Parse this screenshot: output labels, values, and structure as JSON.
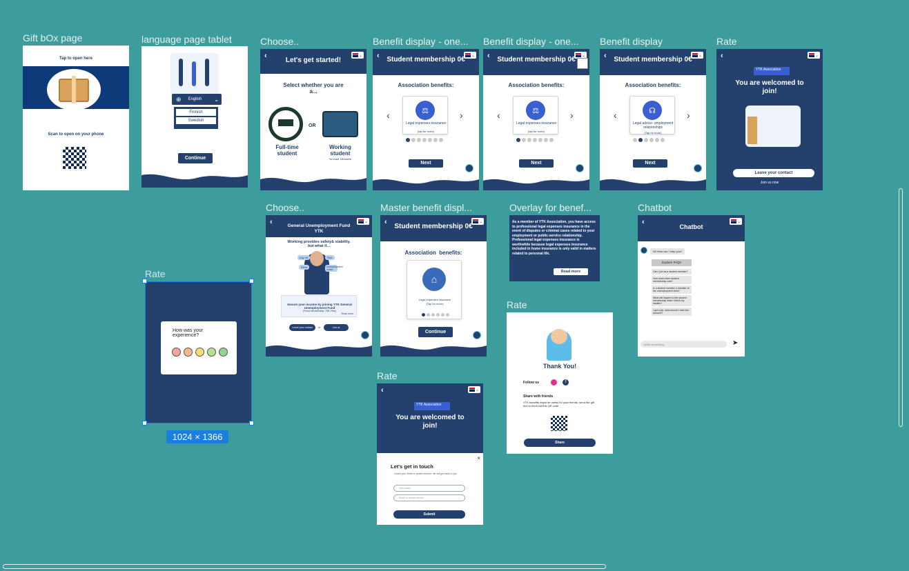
{
  "frames": {
    "gift": {
      "label": "Gift bOx page",
      "tap": "Tap to open here",
      "scan": "Scan to open on your phone"
    },
    "language": {
      "label": "language page tablet",
      "selected": "English",
      "options": [
        "Finnish",
        "Swedish"
      ],
      "continue": "Continue"
    },
    "choose": {
      "label": "Choose..",
      "title": "Let's get started!",
      "question": "Select whether you are a...",
      "or": "OR",
      "opt1": "Full-time student",
      "opt2": "Working student",
      "opt2_note": "*at least 18h/week"
    },
    "benefit1": {
      "label": "Benefit display - one...",
      "title": "Student membership 0€",
      "section": "Association benefits:",
      "card": "Legal expenses insurance",
      "card_sub": "(tap for more)",
      "next": "Next"
    },
    "benefit2": {
      "label": "Benefit display - one...",
      "title": "Student membership 0€",
      "section": "Association benefits:",
      "card": "Legal expenses insurance",
      "card_sub": "(tap for more)",
      "next": "Next"
    },
    "benefit3": {
      "label": "Benefit display",
      "title": "Student membership 0€",
      "section": "Association benefits:",
      "card": "Legal advice- employment relationships",
      "card_sub": "(Tap for more)",
      "next": "Next"
    },
    "rate1": {
      "label": "Rate",
      "badge": "YTK Association",
      "welcome": "You are welcomed to join!",
      "leave": "Leave your contact",
      "join": "Join us now"
    },
    "choose2": {
      "label": "Choose..",
      "title": "General Unemployment Fund YTK",
      "tagline": "Working provides safety& stability, but what if...",
      "bubbles": [
        "Lay off",
        "Sick",
        "Fired",
        "Unemployment notice"
      ],
      "box": "Secure your income by joining YTK General Unemployment Fund",
      "box_sub": "(Fixed membership: 75€/ Year)",
      "read": "Read more",
      "leave": "Leave your contact",
      "or": "or",
      "join": "Join us"
    },
    "master": {
      "label": "Master benefit displ...",
      "title": "Student membership 0€",
      "section": "Association  benefits:",
      "card": "Legal expenses insurance",
      "card_sub": "(Tap for more)",
      "continue": "Continue"
    },
    "overlay": {
      "label": "Overlay for benef...",
      "text": "As a member of YTK Association, you have access to professional legal expenses insurance in the event of disputes or criminal cases related to your employment or public-service relationship. Professional legal expenses insurance is worthwhile because legal expenses insurance included in home insurance is only valid in matters related to personal life.",
      "read": "Read more"
    },
    "chatbot": {
      "label": "Chatbot",
      "title": "Chatbot",
      "greet": "Hi! How can I help you?",
      "explore": "Explore FAQs",
      "faqs": [
        "Can I join as a student member?",
        "How much does student membership cost?",
        "Is a student member a member of the unemployment fund?",
        "What will happen to the student membership when I finish my studies?",
        "I got a job, what should I take into account?"
      ],
      "placeholder": "Write something..."
    },
    "rate2": {
      "label": "Rate",
      "question": "How was your experience?",
      "size": "1024 × 1366"
    },
    "rate3": {
      "label": "Rate",
      "thanks": "Thank You!",
      "follow": "Follow us",
      "share_title": "Share with friends",
      "share_text": "YTK benefits might be useful for your friends, send the gift box to them via this QR code",
      "share": "Share"
    },
    "rate4": {
      "label": "Rate",
      "badge": "YTK Association",
      "welcome": "You are welcomed to join!",
      "touch": "Let's get in touch",
      "touch_sub": "Leave your email or phone number, we will get back to you",
      "name_ph": "Your name",
      "email_ph": "Email or phone number",
      "submit": "Submit"
    }
  },
  "colors": {
    "canvas": "#3d9c9c",
    "navy": "#24416e",
    "accent": "#3a5fd1"
  }
}
